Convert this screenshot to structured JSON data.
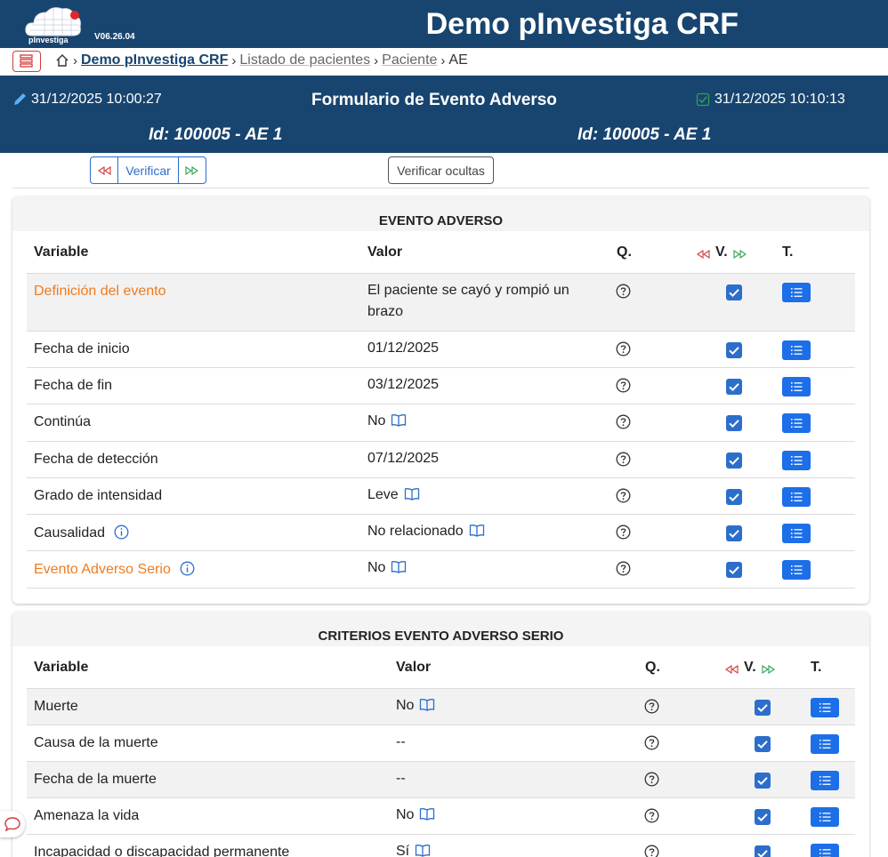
{
  "header": {
    "version": "V06.26.04",
    "logo_text": "pInvestiga",
    "app_title": "Demo pInvestiga CRF"
  },
  "breadcrumb": {
    "items": [
      "Demo pInvestiga CRF",
      "Listado de pacientes",
      "Paciente",
      "AE"
    ]
  },
  "form_header": {
    "created_at": "31/12/2025 10:00:27",
    "title": "Formulario de Evento Adverso",
    "verified_at": "31/12/2025 10:10:13",
    "id_left": "Id: 100005 - AE 1",
    "id_right": "Id: 100005 - AE 1"
  },
  "toolbar": {
    "verify_label": "Verificar",
    "verify_hidden_label": "Verificar ocultas"
  },
  "colors": {
    "primary": "#18456f",
    "accent_blue": "#1c6fe8",
    "orange_label": "#f07b1d",
    "prev_arrows": "#d23a3a",
    "next_arrows": "#2ea44f"
  },
  "sections": [
    {
      "title": "EVENTO ADVERSO",
      "columns": {
        "variable": "Variable",
        "value": "Valor",
        "q": "Q.",
        "v": "V.",
        "t": "T."
      },
      "rows": [
        {
          "variable": "Definición del evento",
          "value_line1": "El paciente se cayó y rompió un",
          "value_line2": "brazo",
          "highlight": true,
          "book": false,
          "info": false,
          "verified": true
        },
        {
          "variable": "Fecha de inicio",
          "value_line1": "01/12/2025",
          "value_line2": "",
          "highlight": false,
          "book": false,
          "info": false,
          "verified": true
        },
        {
          "variable": "Fecha de fin",
          "value_line1": "03/12/2025",
          "value_line2": "",
          "highlight": false,
          "book": false,
          "info": false,
          "verified": true
        },
        {
          "variable": "Continúa",
          "value_line1": "No",
          "value_line2": "",
          "highlight": false,
          "book": true,
          "info": false,
          "verified": true
        },
        {
          "variable": "Fecha de detección",
          "value_line1": "07/12/2025",
          "value_line2": "",
          "highlight": false,
          "book": false,
          "info": false,
          "verified": true
        },
        {
          "variable": "Grado de intensidad",
          "value_line1": "Leve",
          "value_line2": "",
          "highlight": false,
          "book": true,
          "info": false,
          "verified": true
        },
        {
          "variable": "Causalidad",
          "value_line1": "No relacionado",
          "value_line2": "",
          "highlight": false,
          "book": true,
          "info": true,
          "verified": true
        },
        {
          "variable": "Evento Adverso Serio",
          "value_line1": "No",
          "value_line2": "",
          "highlight": true,
          "book": true,
          "info": true,
          "verified": true
        }
      ]
    },
    {
      "title": "CRITERIOS EVENTO ADVERSO SERIO",
      "columns": {
        "variable": "Variable",
        "value": "Valor",
        "q": "Q.",
        "v": "V.",
        "t": "T."
      },
      "rows": [
        {
          "variable": "Muerte",
          "value_line1": "No",
          "value_line2": "",
          "highlight": false,
          "book": true,
          "info": false,
          "verified": true
        },
        {
          "variable": "Causa de la muerte",
          "value_line1": "--",
          "value_line2": "",
          "highlight": false,
          "book": false,
          "info": false,
          "verified": true
        },
        {
          "variable": "Fecha de la muerte",
          "value_line1": "--",
          "value_line2": "",
          "highlight": false,
          "book": false,
          "info": false,
          "verified": true
        },
        {
          "variable": "Amenaza la vida",
          "value_line1": "No",
          "value_line2": "",
          "highlight": false,
          "book": true,
          "info": false,
          "verified": true
        },
        {
          "variable": "Incapacidad o discapacidad permanente",
          "value_line1": "Sí",
          "value_line2": "",
          "highlight": false,
          "book": true,
          "info": false,
          "verified": true
        }
      ]
    }
  ]
}
